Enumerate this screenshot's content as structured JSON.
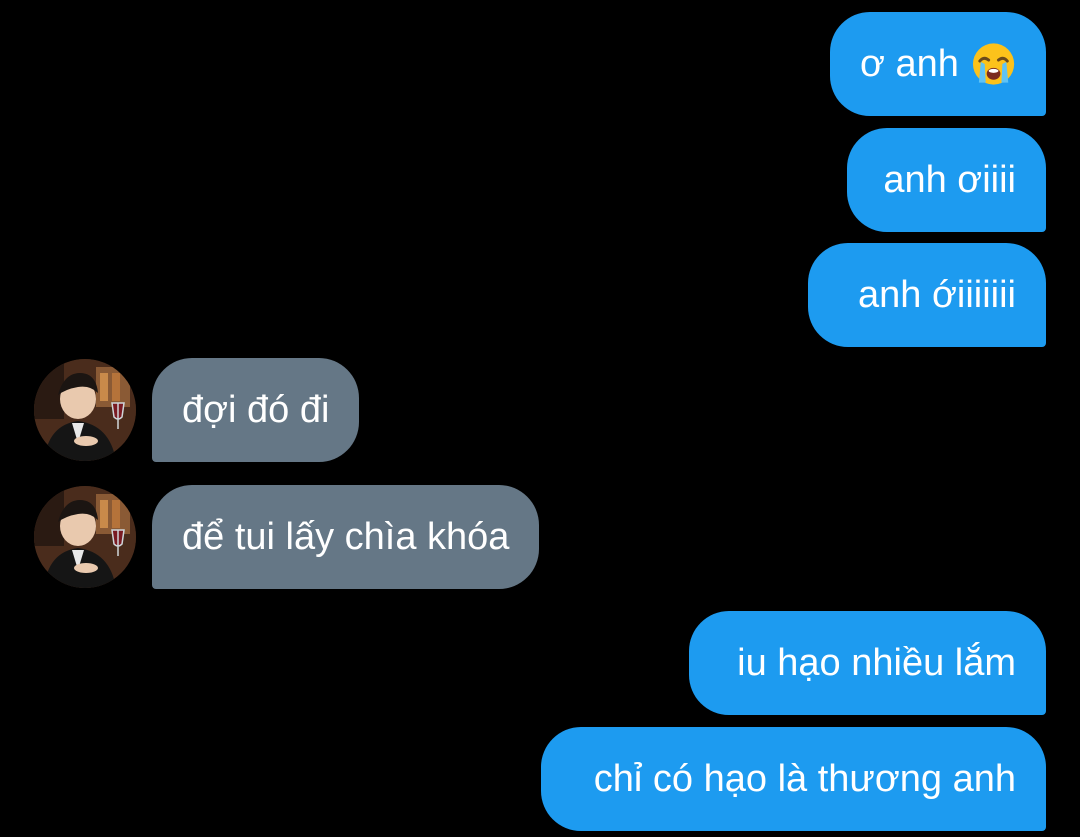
{
  "colors": {
    "background": "#000000",
    "outgoing_bubble": "#1d9bf0",
    "incoming_bubble": "#657786",
    "text": "#ffffff"
  },
  "messages": [
    {
      "direction": "outgoing",
      "text": "ơ anh",
      "emoji": "loudly-crying-face-emoji"
    },
    {
      "direction": "outgoing",
      "text": "anh ơiiii"
    },
    {
      "direction": "outgoing",
      "text": "anh ớiiiiiii"
    },
    {
      "direction": "incoming",
      "text": "đợi đó đi",
      "avatar": "contact-avatar"
    },
    {
      "direction": "incoming",
      "text": "để tui lấy chìa khóa",
      "avatar": "contact-avatar"
    },
    {
      "direction": "outgoing",
      "text": "iu hạo nhiều lắm"
    },
    {
      "direction": "outgoing",
      "text": "chỉ có hạo là thương anh"
    }
  ]
}
